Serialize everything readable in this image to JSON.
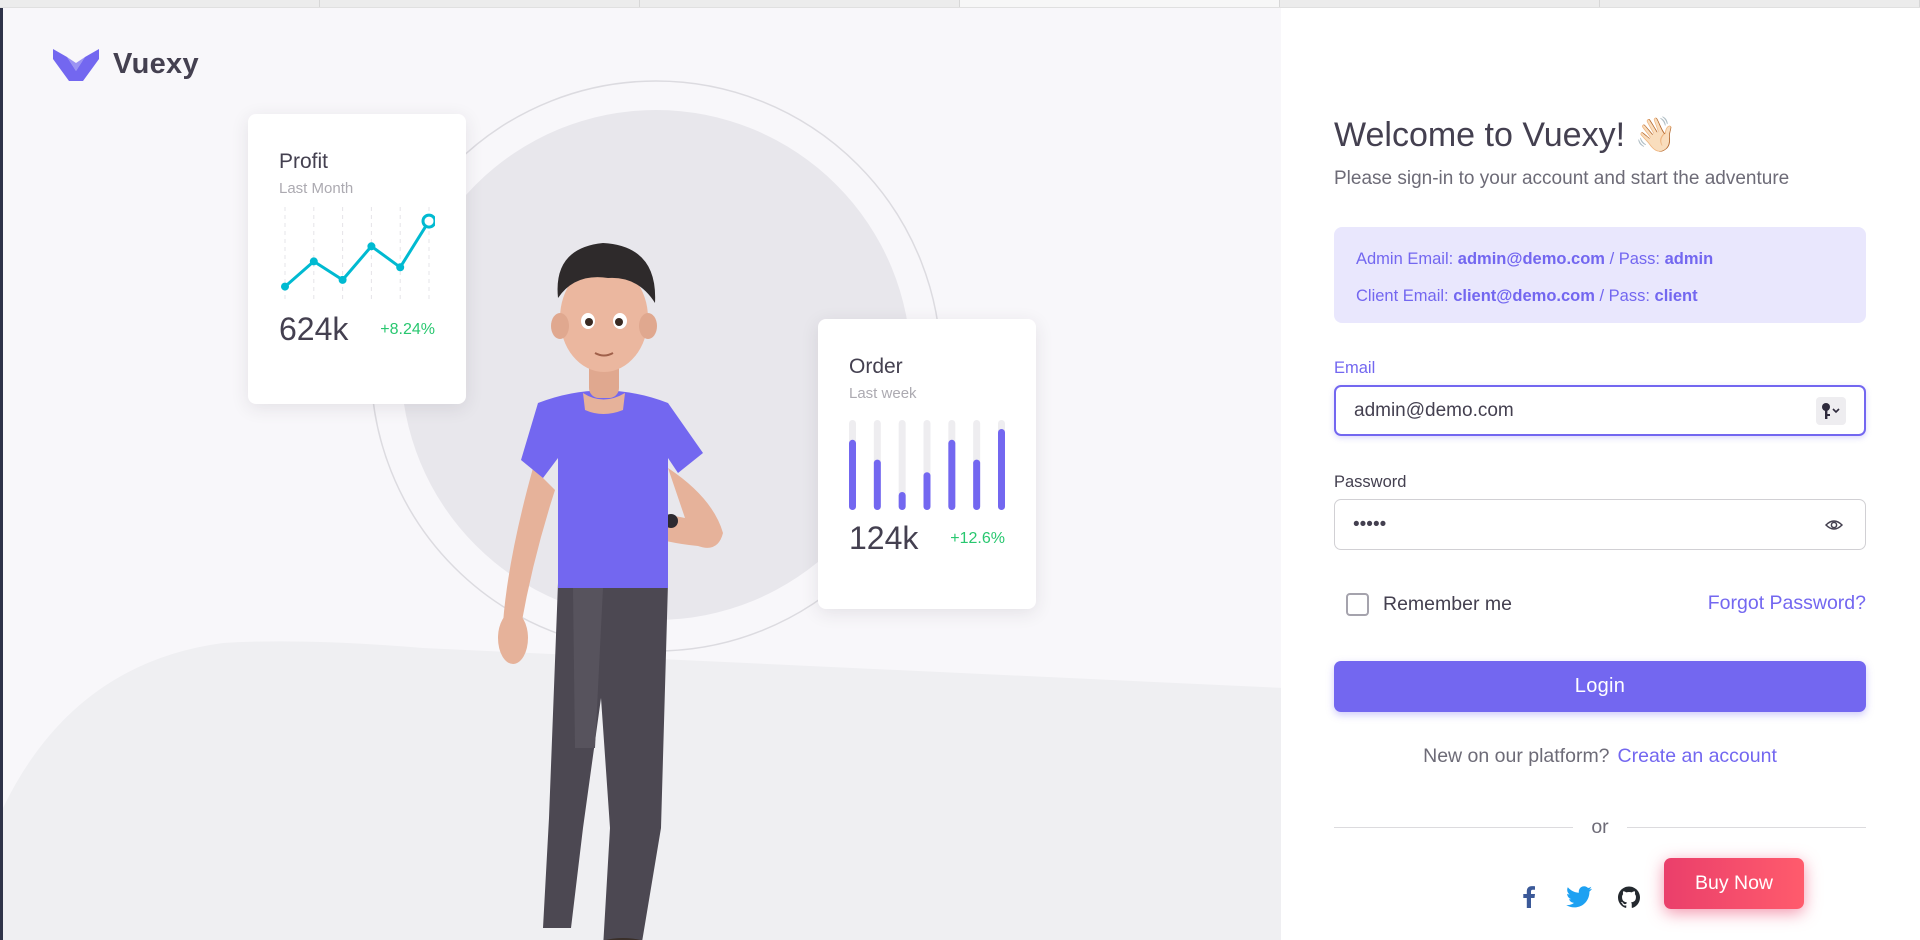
{
  "brand": {
    "name": "Vuexy",
    "accent": "#7367f0"
  },
  "profit_card": {
    "title": "Profit",
    "subtitle": "Last Month",
    "value": "624k",
    "delta": "+8.24%",
    "sparkline": [
      10,
      40,
      18,
      58,
      33,
      88
    ],
    "line_color": "#00bad1"
  },
  "order_card": {
    "title": "Order",
    "subtitle": "Last week",
    "value": "124k",
    "delta": "+12.6%",
    "bars": [
      0.78,
      0.56,
      0.2,
      0.42,
      0.78,
      0.56,
      0.9
    ],
    "bar_color": "#7367f0"
  },
  "login": {
    "welcome": "Welcome to Vuexy! 👋🏻",
    "subtitle": "Please sign-in to your account and start the adventure",
    "alert": {
      "admin_label": "Admin Email: ",
      "admin_email": "admin@demo.com",
      "pass_label": " / Pass: ",
      "admin_pass": "admin",
      "client_label": "Client Email: ",
      "client_email": "client@demo.com",
      "client_pass": "client"
    },
    "email_label": "Email",
    "email_value": "admin@demo.com",
    "password_label": "Password",
    "password_value": "admin",
    "remember_label": "Remember me",
    "remember_checked": false,
    "forgot": "Forgot Password?",
    "login_button": "Login",
    "new_text": "New on our platform?",
    "create_link": "Create an account",
    "or": "or",
    "socials": [
      "facebook-icon",
      "twitter-icon",
      "github-icon"
    ]
  },
  "buy_now": {
    "label": "Buy Now",
    "color": "#ea3f6b"
  }
}
